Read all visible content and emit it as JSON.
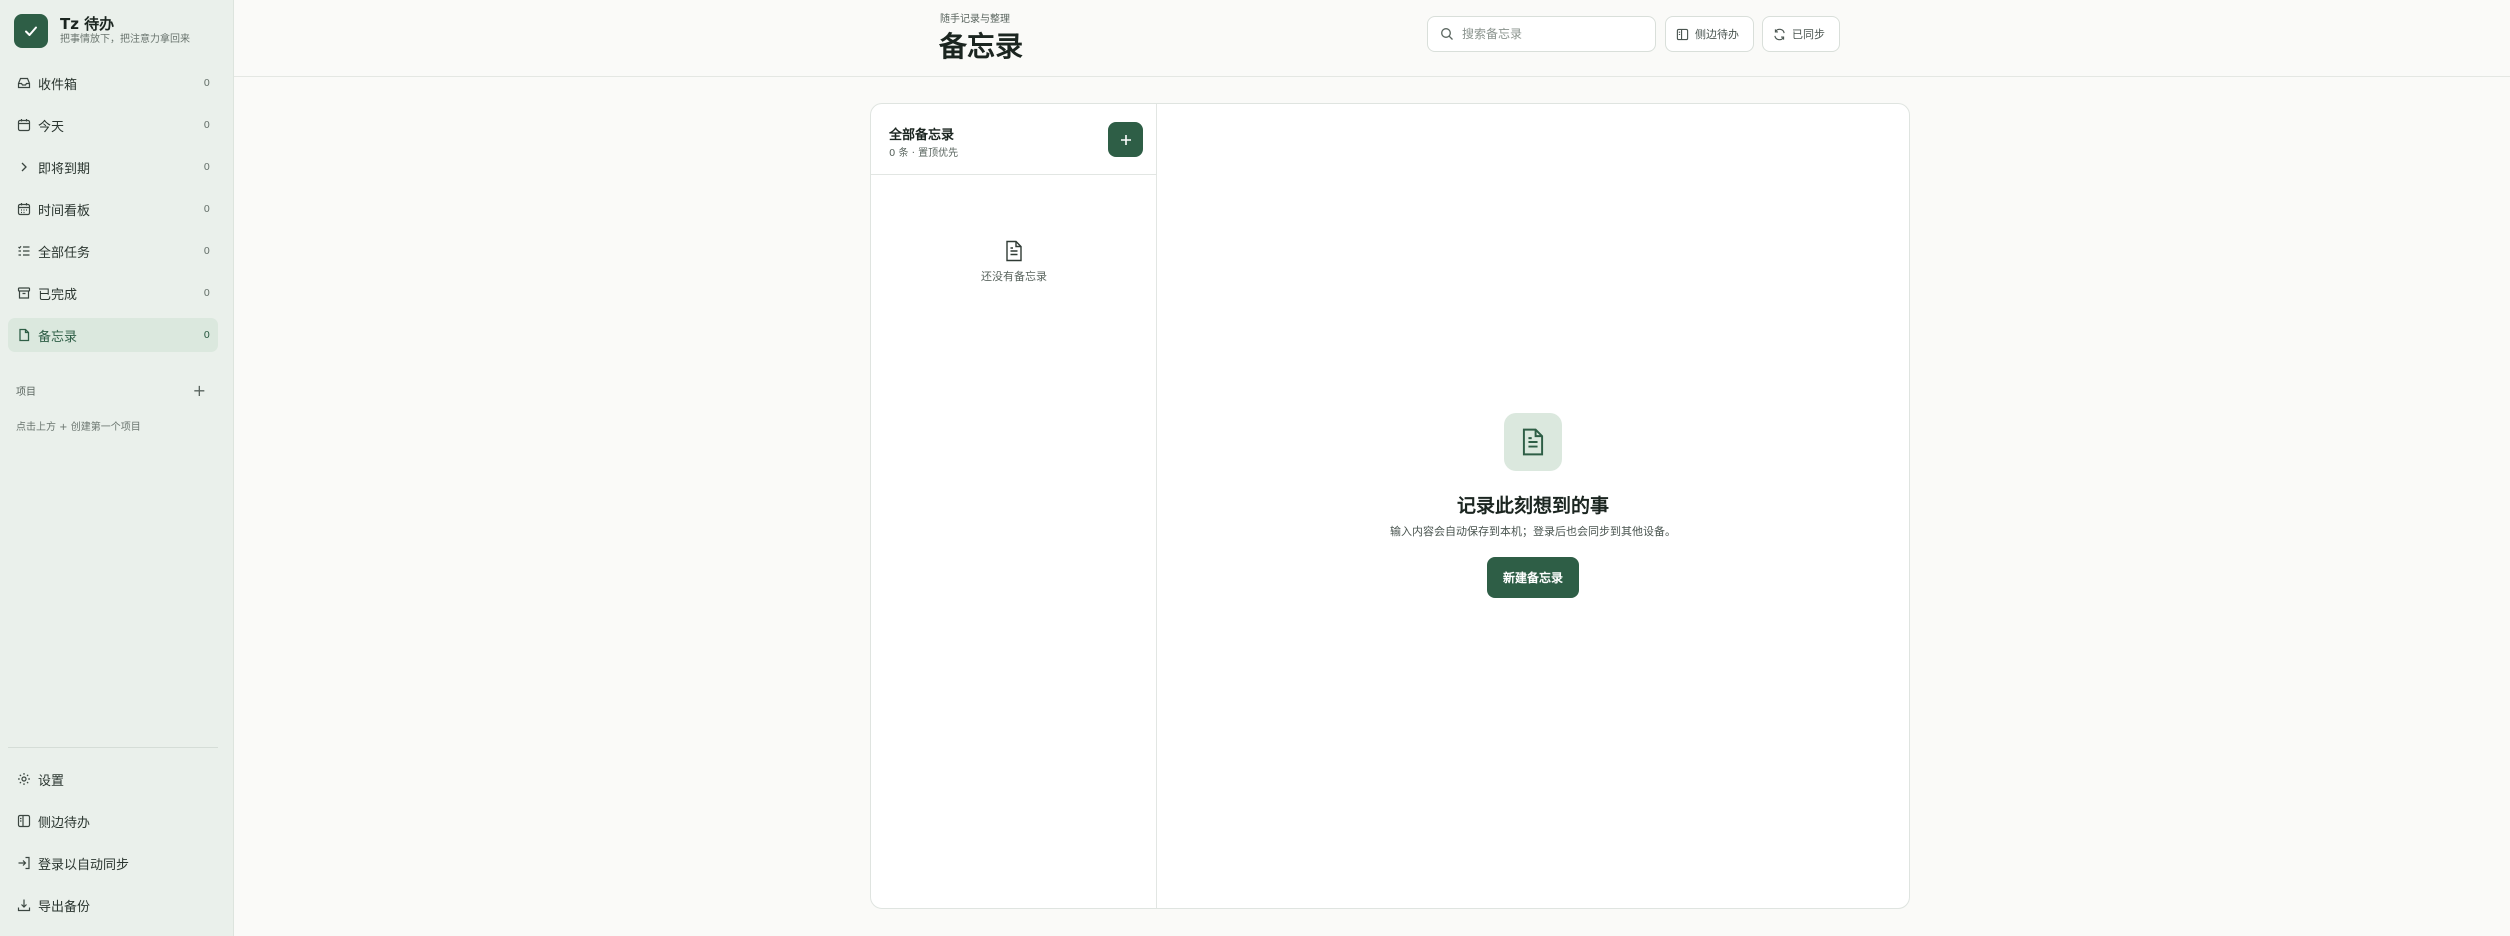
{
  "app": {
    "title": "Tz 待办",
    "subtitle": "把事情放下，把注意力拿回来"
  },
  "nav": [
    {
      "label": "收件箱",
      "count": "0",
      "icon": "inbox-icon"
    },
    {
      "label": "今天",
      "count": "0",
      "icon": "calendar-icon"
    },
    {
      "label": "即将到期",
      "count": "0",
      "icon": "chevron-right-icon"
    },
    {
      "label": "时间看板",
      "count": "0",
      "icon": "calendar-grid-icon"
    },
    {
      "label": "全部任务",
      "count": "0",
      "icon": "list-check-icon"
    },
    {
      "label": "已完成",
      "count": "0",
      "icon": "archive-icon"
    },
    {
      "label": "备忘录",
      "count": "0",
      "icon": "note-icon",
      "active": true
    }
  ],
  "projects": {
    "title": "项目",
    "hint": "点击上方 + 创建第一个项目"
  },
  "bottom_nav": [
    {
      "label": "设置",
      "icon": "gear-icon"
    },
    {
      "label": "侧边待办",
      "icon": "sidebar-panel-icon"
    },
    {
      "label": "登录以自动同步",
      "icon": "login-icon"
    },
    {
      "label": "导出备份",
      "icon": "download-icon"
    }
  ],
  "header": {
    "kicker": "随手记录与整理",
    "title": "备忘录",
    "search_placeholder": "搜索备忘录",
    "side_todo_label": "侧边待办",
    "sync_label": "已同步"
  },
  "list": {
    "title": "全部备忘录",
    "meta": "0 条 · 置顶优先",
    "empty_text": "还没有备忘录"
  },
  "empty_state": {
    "title": "记录此刻想到的事",
    "description": "输入内容会自动保存到本机；登录后也会同步到其他设备。",
    "button_label": "新建备忘录"
  },
  "colors": {
    "accent": "#2e5e46",
    "accent_soft": "#dbe8de",
    "sidebar_bg": "#eaf0eb"
  }
}
